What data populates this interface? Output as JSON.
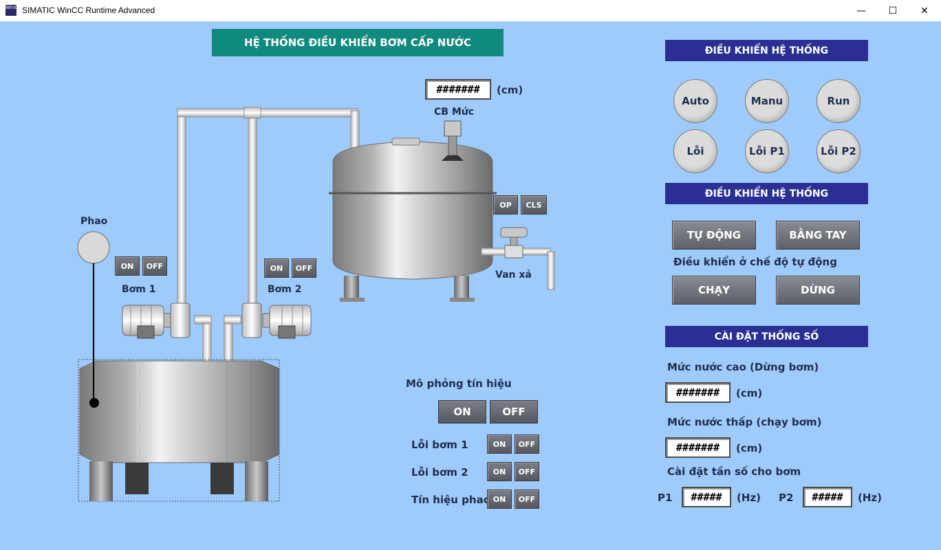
{
  "window": {
    "title": "SIMATIC WinCC Runtime Advanced",
    "icon_text": "WinCC"
  },
  "header": {
    "title": "HỆ THỐNG ĐIỀU KHIỂN BƠM CẤP NƯỚC"
  },
  "sensor": {
    "value": "#######",
    "unit": "(cm)",
    "label": "CB Mức"
  },
  "labels": {
    "phao": "Phao",
    "pump1": "Bơm 1",
    "pump2": "Bơm 2",
    "valve": "Van xả"
  },
  "pump1_buttons": {
    "on": "ON",
    "off": "OFF"
  },
  "pump2_buttons": {
    "on": "ON",
    "off": "OFF"
  },
  "valve_buttons": {
    "open": "OP",
    "close": "CLS"
  },
  "simulation": {
    "title": "Mô phỏng tín hiệu",
    "on": "ON",
    "off": "OFF",
    "rows": [
      {
        "label": "Lỗi bơm 1",
        "on": "ON",
        "off": "OFF"
      },
      {
        "label": "Lỗi bơm 2",
        "on": "ON",
        "off": "OFF"
      },
      {
        "label": "Tín hiệu phao",
        "on": "ON",
        "off": "OFF"
      }
    ]
  },
  "status_panel": {
    "title": "ĐIỀU KHIỂN HỆ THỐNG",
    "indicators": [
      "Auto",
      "Manu",
      "Run",
      "Lỗi",
      "Lỗi P1",
      "Lỗi P2"
    ]
  },
  "control_panel": {
    "title": "ĐIỀU KHIỂN HỆ THỐNG",
    "auto": "TỰ ĐỘNG",
    "manual": "BẰNG TAY",
    "note": "Điều khiển ở chế độ tự động",
    "run": "CHẠY",
    "stop": "DỪNG"
  },
  "settings": {
    "title": "CÀI ĐẶT THỐNG SỐ",
    "high_label": "Mức nước cao (Dừng bơm)",
    "high_value": "#######",
    "high_unit": "(cm)",
    "low_label": "Mức nước thấp (chạy bơm)",
    "low_value": "#######",
    "low_unit": "(cm)",
    "freq_label": "Cài đặt tần số cho bơm",
    "p1_label": "P1",
    "p1_value": "#####",
    "p1_unit": "(Hz)",
    "p2_label": "P2",
    "p2_value": "#####",
    "p2_unit": "(Hz)"
  },
  "colors": {
    "background": "#9ecbfb",
    "title_bg": "#118a7e",
    "header_bg": "#2b2f93",
    "button": "#65676e"
  }
}
